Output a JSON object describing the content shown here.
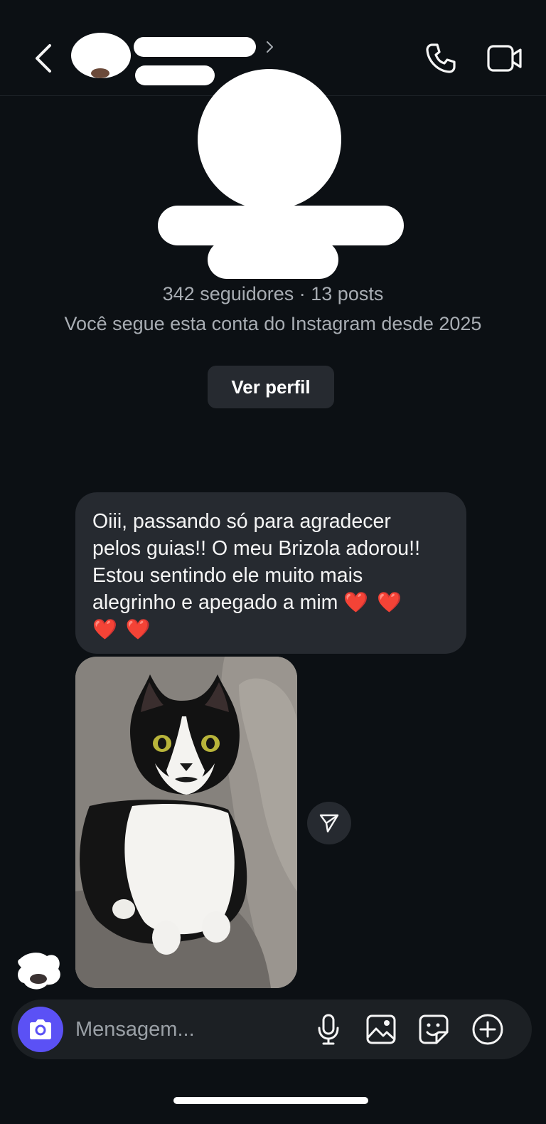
{
  "header": {
    "back_icon": "chevron-left-icon",
    "title_chevron_icon": "chevron-right-icon",
    "call_icon": "phone-icon",
    "video_icon": "video-camera-icon"
  },
  "profile": {
    "stats": "342 seguidores · 13 posts",
    "follow_since": "Você segue esta conta do Instagram desde 2025",
    "view_profile_label": "Ver perfil"
  },
  "messages": {
    "text_lines": [
      "Oiii, passando só para agradecer",
      "pelos guias!! O meu Brizola adorou!!",
      "Estou sentindo ele muito mais",
      "alegrinho e apegado a mim"
    ],
    "hearts_line1": "❤️ ❤️",
    "hearts_line2": "❤️ ❤️",
    "share_icon": "paper-plane-icon"
  },
  "composer": {
    "placeholder": "Mensagem...",
    "camera_icon": "camera-icon",
    "mic_icon": "microphone-icon",
    "gallery_icon": "image-icon",
    "sticker_icon": "sticker-icon",
    "plus_icon": "plus-circle-icon"
  },
  "colors": {
    "background": "#0c1014",
    "bubble": "#262a30",
    "accent": "#5b51f5",
    "heart": "#ff2d3f"
  }
}
